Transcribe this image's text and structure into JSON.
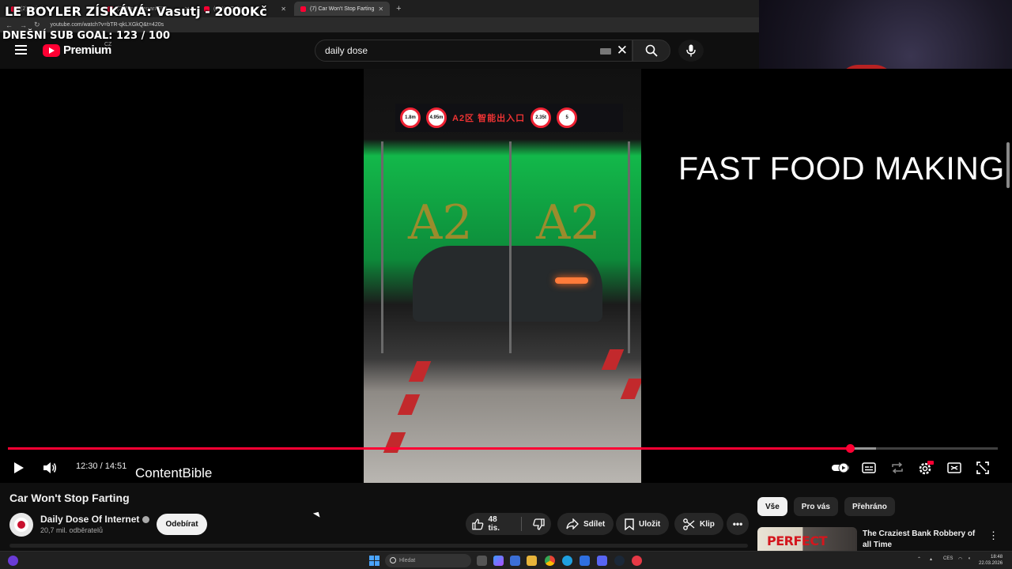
{
  "browser": {
    "tabs": [
      {
        "label": "(2) Twitch"
      },
      {
        "label": "(2) Nový Ferrari F80"
      },
      {
        "label": "(2) YouTube"
      },
      {
        "label": "(7) Car Won't Stop Farting",
        "active": true
      }
    ],
    "url": "youtube.com/watch?v=bTR-qkLXGkQ&t=420s"
  },
  "stream_overlay": {
    "title": "LE BOYLER ZÍSKÁVÁ: Vasutj - 2000Kč",
    "goal": "DNEŠNÍ SUB GOAL:  123 / 100"
  },
  "masthead": {
    "brand": "Premium",
    "country": "CZ",
    "search_value": "daily dose"
  },
  "video": {
    "overlay_text": "FAST FOOD MAKING",
    "watermark": "ContentBible",
    "time": "12:30 / 14:51",
    "progress_played": 0.851,
    "progress_buffered": 0.877,
    "sign_text": "A2区 智能出入口",
    "sign_labels": [
      "1.8m",
      "4.95m",
      "2.35t",
      "5"
    ],
    "zone_label": "A2"
  },
  "details": {
    "title": "Car Won't Stop Farting",
    "channel": "Daily Dose Of Internet",
    "subscribers": "20,7 mil. odběratelů",
    "subscribe_label": "Odebírat",
    "likes": "48 tis.",
    "share_label": "Sdílet",
    "save_label": "Uložit",
    "clip_label": "Klip"
  },
  "sidebar": {
    "chips": [
      "Vše",
      "Pro vás",
      "Přehráno"
    ],
    "recommendation": {
      "title": "The Craziest Bank Robbery of all Time",
      "thumb_text": "PERFECT"
    }
  },
  "taskbar": {
    "search_placeholder": "Hledat",
    "language": "CES",
    "time": "18:48",
    "date": "22.03.2026"
  },
  "colors": {
    "accent": "#ff0033",
    "background": "#0f0f0f"
  }
}
